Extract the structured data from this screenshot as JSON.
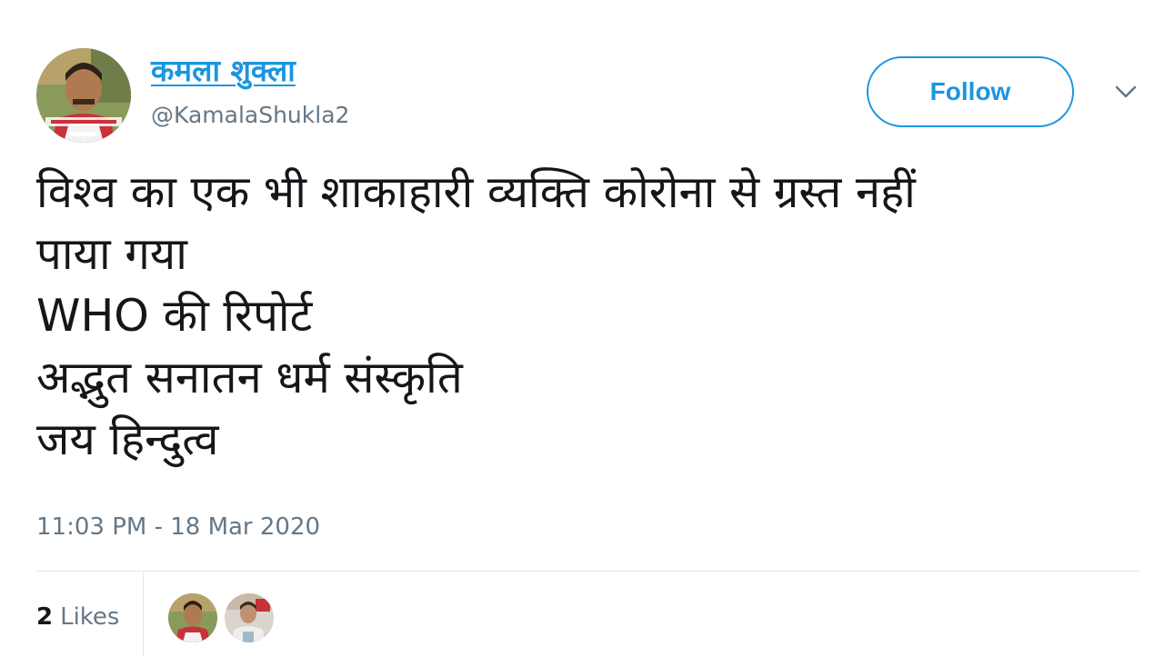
{
  "author": {
    "display_name": "कमला शुक्ला",
    "handle": "@KamalaShukla2",
    "avatar_icon": "profile-photo-avatar"
  },
  "follow_button": {
    "label": "Follow"
  },
  "menu": {
    "icon": "chevron-down-icon"
  },
  "tweet": {
    "lines": [
      "विश्व का एक भी शाकाहारी व्यक्ति कोरोना से ग्रस्त नहीं",
      "पाया गया",
      "WHO की रिपोर्ट",
      "अद्भुत सनातन धर्म संस्कृति",
      "जय हिन्दुत्व"
    ],
    "timestamp": "11:03 PM - 18 Mar 2020"
  },
  "likes": {
    "count": "2",
    "label": "Likes",
    "liker_icons": [
      "liker-avatar-1",
      "liker-avatar-2"
    ]
  },
  "colors": {
    "accent": "#1b95e0",
    "secondary_text": "#657786",
    "primary_text": "#14171a",
    "divider": "#e1e8ed"
  }
}
